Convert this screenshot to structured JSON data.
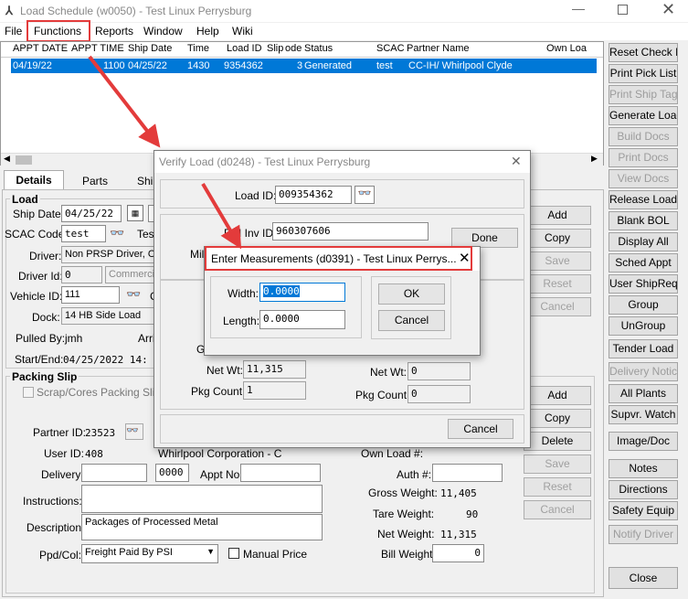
{
  "titlebar": {
    "title": "Load Schedule (w0050) - Test Linux Perrysburg"
  },
  "menu": [
    "File",
    "Functions",
    "Reports",
    "Window",
    "Help",
    "Wiki"
  ],
  "grid": {
    "columns": [
      "APPT DATE",
      "APPT TIME",
      "Ship Date",
      "Time",
      "Load ID",
      "Slip",
      "ode",
      "Status",
      "SCAC",
      "Partner Name",
      "Own Loa"
    ],
    "row": [
      "04/19/22",
      "1100",
      "04/25/22",
      "1430",
      "9354362",
      "3",
      "",
      "Generated",
      "test",
      "CC-IH/ Whirlpool Clyde",
      ""
    ]
  },
  "tabs": [
    "Details",
    "Parts",
    "Ship"
  ],
  "load": {
    "section": "Load",
    "ship_date_label": "Ship Date:",
    "ship_date": "04/25/22",
    "scac_label": "SCAC Code:",
    "scac": "test",
    "scac_name": "Tes",
    "driver_label": "Driver:",
    "driver": "Non PRSP Driver, O",
    "driver_id_label": "Driver Id:",
    "driver_id": "0",
    "commercial": "Commercia",
    "vehicle_label": "Vehicle ID:",
    "vehicle": "111",
    "vehicle_extra": "C",
    "dock_label": "Dock:",
    "dock": "14 HB Side Load",
    "pulled_label": "Pulled By:",
    "pulled": "jmh",
    "arrive_label": "Arriv",
    "startend_label": "Start/End:",
    "startend": "04/25/2022 14:"
  },
  "load_buttons": [
    "Add",
    "Copy",
    "Save",
    "Reset",
    "Cancel"
  ],
  "packing": {
    "section": "Packing Slip",
    "scrap_label": "Scrap/Cores Packing Slip",
    "partner_label": "Partner ID:",
    "partner": "23523",
    "partner_name": "Whirlpool Corporation - C",
    "user_label": "User ID:",
    "user": "408",
    "own_load_label": "Own Load #:",
    "delivery_label": "Delivery:",
    "delivery": "",
    "delivery_num": "0000",
    "appt_label": "Appt No:",
    "appt": "",
    "auth_label": "Auth #:",
    "auth": "",
    "instructions_label": "Instructions:",
    "instructions": "",
    "description_label": "Description:",
    "description": "Packages of Processed Metal",
    "gross_label": "Gross Weight:",
    "gross": "11,405",
    "tare_label": "Tare Weight:",
    "tare": "90",
    "net_label": "Net Weight:",
    "net": "11,315",
    "bill_label": "Bill Weight:",
    "bill": "0",
    "ppd_label": "Ppd/Col:",
    "ppd": "Freight Paid By PSI",
    "manual_price": "Manual Price"
  },
  "packing_buttons": [
    "Add",
    "Copy",
    "Delete",
    "Save",
    "Reset",
    "Cancel"
  ],
  "side_buttons": [
    "Reset Check In",
    "Print Pick List",
    "Print Ship Tag",
    "Generate Load",
    "Build Docs",
    "Print Docs",
    "View Docs",
    "Release Load",
    "Blank BOL",
    "Display All",
    "Sched Appt",
    "User ShipReq",
    "Group",
    "UnGroup",
    "Tender Load",
    "Delivery Notice",
    "All Plants",
    "Supvr. Watch",
    "Image/Doc",
    "Notes",
    "Directions",
    "Safety Equip",
    "Notify Driver",
    "Close"
  ],
  "verify": {
    "title": "Verify Load (d0248) - Test Linux Perrysburg",
    "load_id_label": "Load ID:",
    "load_id": "009354362",
    "psi_inv_label": "PSI Inv ID:",
    "psi_inv": "960307606",
    "done": "Done",
    "mill_label": "Mill",
    "gr_label": "Gr",
    "net_wt_label": "Net Wt:",
    "net_wt": "11,315",
    "pkg_label": "Pkg Count:",
    "pkg": "1",
    "net_wt2": "0",
    "pkg2": "0",
    "cancel": "Cancel"
  },
  "measure": {
    "title": "Enter Measurements (d0391) - Test Linux Perrys...",
    "width_label": "Width:",
    "width": "0.0000",
    "length_label": "Length:",
    "length": "0.0000",
    "ok": "OK",
    "cancel": "Cancel"
  },
  "colors": {
    "selection": "#0078d7",
    "annotation": "#e33b3b"
  }
}
